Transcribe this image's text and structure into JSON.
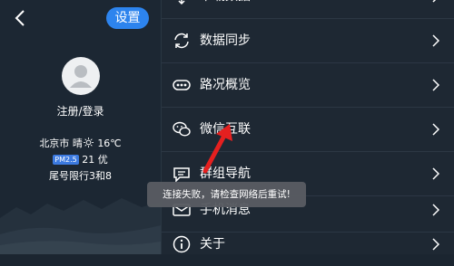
{
  "header": {
    "settings_label": "设置"
  },
  "profile": {
    "login_label": "注册/登录"
  },
  "weather": {
    "city": "北京市",
    "condition": "晴",
    "temperature": "16℃",
    "pm_badge": "PM2.5",
    "aqi_value": "21",
    "aqi_level": "优",
    "plate_restriction": "尾号限行3和8"
  },
  "menu": {
    "items": [
      {
        "label": "下载数据",
        "icon": "download-icon"
      },
      {
        "label": "数据同步",
        "icon": "sync-icon"
      },
      {
        "label": "路况概览",
        "icon": "traffic-overview-icon"
      },
      {
        "label": "微信互联",
        "icon": "wechat-icon"
      },
      {
        "label": "群组导航",
        "icon": "group-navigation-icon"
      },
      {
        "label": "手机消息",
        "icon": "message-icon"
      },
      {
        "label": "关于",
        "icon": "info-icon"
      }
    ]
  },
  "toast": {
    "message": "连接失败，请检查网络后重试!"
  },
  "colors": {
    "accent": "#2d84ee",
    "annotation_arrow": "#e5201f",
    "background": "#1e2833"
  }
}
